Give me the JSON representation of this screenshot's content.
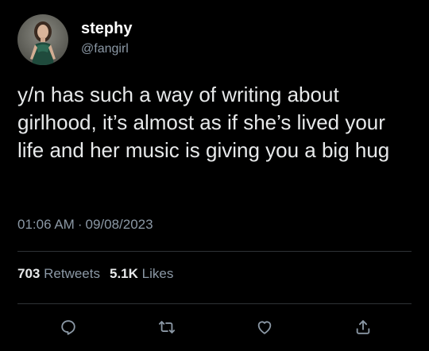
{
  "user": {
    "display_name": "stephy",
    "handle": "@fangirl",
    "avatar_icon": "profile-photo"
  },
  "tweet": {
    "text": "y/n has such a way of writing about girlhood, it’s almost as if she’s lived your life and her music is giving you a big hug",
    "time": "01:06 AM",
    "separator": "·",
    "date": "09/08/2023"
  },
  "stats": {
    "retweets_count": "703",
    "retweets_label": "Retweets",
    "likes_count": "5.1K",
    "likes_label": "Likes"
  },
  "actions": {
    "reply_icon": "reply-icon",
    "retweet_icon": "retweet-icon",
    "like_icon": "heart-icon",
    "share_icon": "share-icon"
  },
  "colors": {
    "background": "#000000",
    "text_primary": "#e7e9ea",
    "text_secondary": "#8b98a5",
    "divider": "#2f3336"
  }
}
